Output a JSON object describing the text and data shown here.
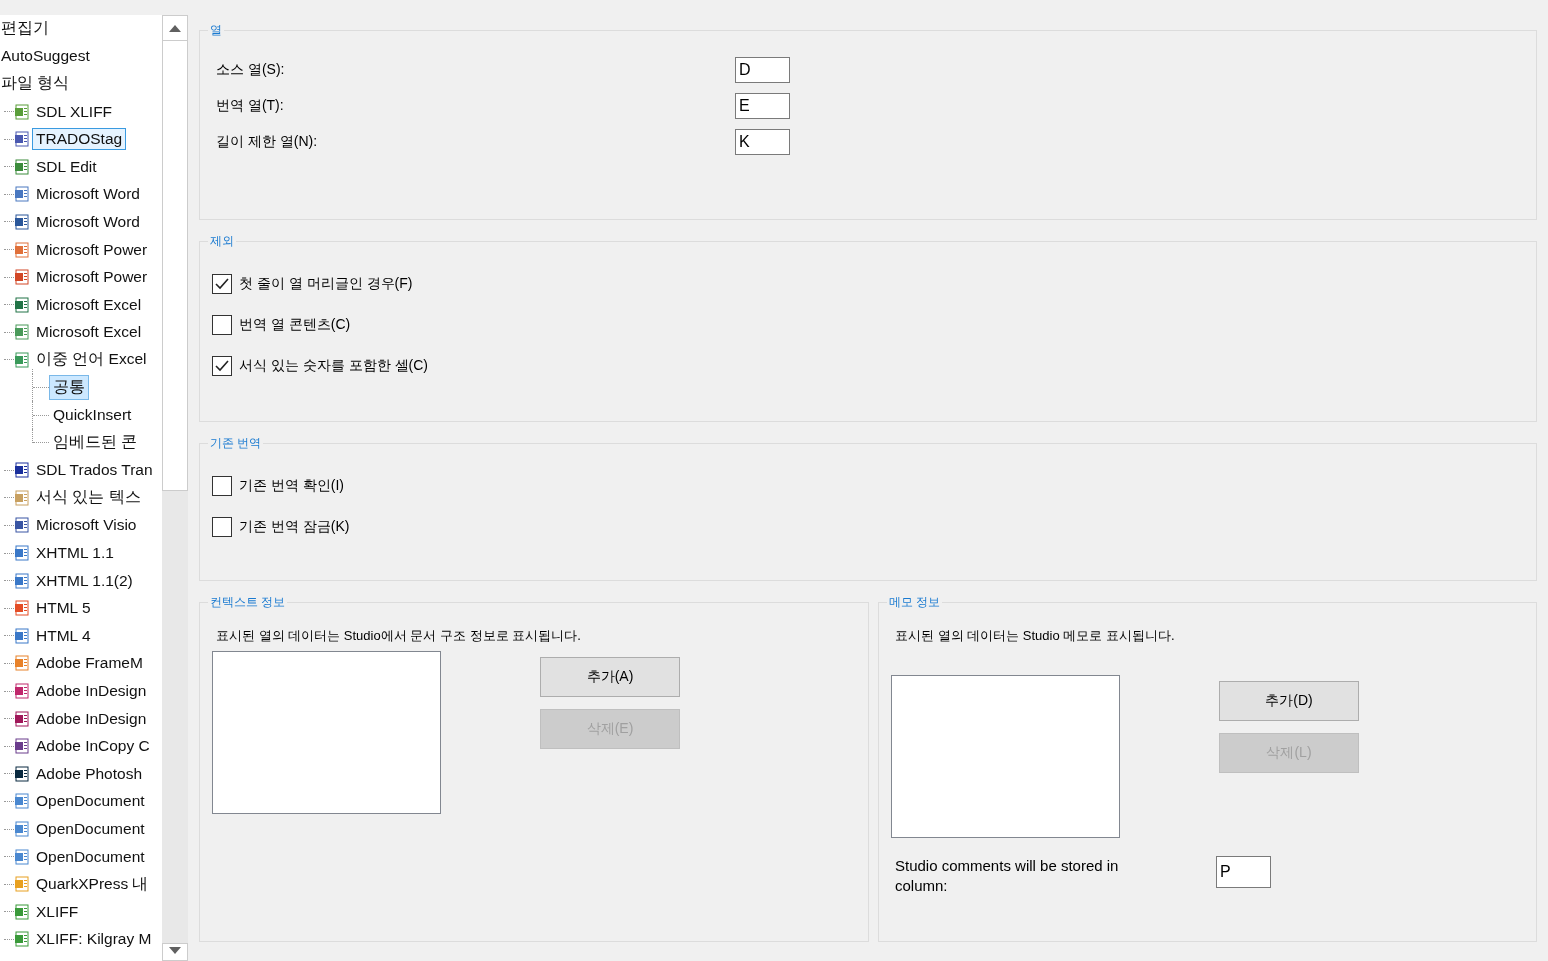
{
  "tree": {
    "items": [
      {
        "label": "편집기",
        "selected": false,
        "hovered": false
      },
      {
        "label": "AutoSuggest",
        "selected": false,
        "hovered": false
      },
      {
        "label": "파일 형식",
        "selected": false,
        "hovered": false,
        "children": [
          {
            "label": "SDL XLIFF",
            "selected": false,
            "hovered": false,
            "color": "#5a9e3a"
          },
          {
            "label": "TRADOStag",
            "selected": false,
            "hovered": true,
            "color": "#4a58b0"
          },
          {
            "label": "SDL Edit",
            "selected": false,
            "hovered": false,
            "color": "#3c8c3c"
          },
          {
            "label": "Microsoft Word",
            "selected": false,
            "hovered": false,
            "color": "#4a78c0"
          },
          {
            "label": "Microsoft Word",
            "selected": false,
            "hovered": false,
            "color": "#2b579a"
          },
          {
            "label": "Microsoft Power",
            "selected": false,
            "hovered": false,
            "color": "#e0703a"
          },
          {
            "label": "Microsoft Power",
            "selected": false,
            "hovered": false,
            "color": "#d24726"
          },
          {
            "label": "Microsoft Excel",
            "selected": false,
            "hovered": false,
            "color": "#217346"
          },
          {
            "label": "Microsoft Excel",
            "selected": false,
            "hovered": false,
            "color": "#4a9a5a"
          },
          {
            "label": "이중 언어 Excel",
            "selected": false,
            "hovered": false,
            "color": "#3a9a5a",
            "children": [
              {
                "label": "공통",
                "selected": true,
                "hovered": false
              },
              {
                "label": "QuickInsert",
                "selected": false,
                "hovered": false
              },
              {
                "label": "임베드된 콘",
                "selected": false,
                "hovered": false
              }
            ]
          },
          {
            "label": "SDL Trados Tran",
            "selected": false,
            "hovered": false,
            "color": "#1a2f9c"
          },
          {
            "label": "서식 있는 텍스",
            "selected": false,
            "hovered": false,
            "color": "#c8a060"
          },
          {
            "label": "Microsoft Visio",
            "selected": false,
            "hovered": false,
            "color": "#3955a3"
          },
          {
            "label": "XHTML 1.1",
            "selected": false,
            "hovered": false,
            "color": "#3a78c8"
          },
          {
            "label": "XHTML 1.1(2)",
            "selected": false,
            "hovered": false,
            "color": "#3a78c8"
          },
          {
            "label": "HTML 5",
            "selected": false,
            "hovered": false,
            "color": "#e44d26"
          },
          {
            "label": "HTML 4",
            "selected": false,
            "hovered": false,
            "color": "#3a78c8"
          },
          {
            "label": "Adobe FrameM",
            "selected": false,
            "hovered": false,
            "color": "#e8822a"
          },
          {
            "label": "Adobe InDesign",
            "selected": false,
            "hovered": false,
            "color": "#c0286c"
          },
          {
            "label": "Adobe InDesign",
            "selected": false,
            "hovered": false,
            "color": "#a0185a"
          },
          {
            "label": "Adobe InCopy C",
            "selected": false,
            "hovered": false,
            "color": "#6a3c8c"
          },
          {
            "label": "Adobe Photosh",
            "selected": false,
            "hovered": false,
            "color": "#0a2a40"
          },
          {
            "label": "OpenDocument",
            "selected": false,
            "hovered": false,
            "color": "#4a88d0"
          },
          {
            "label": "OpenDocument",
            "selected": false,
            "hovered": false,
            "color": "#4a88d0"
          },
          {
            "label": "OpenDocument",
            "selected": false,
            "hovered": false,
            "color": "#4a88d0"
          },
          {
            "label": "QuarkXPress 내",
            "selected": false,
            "hovered": false,
            "color": "#e8a020"
          },
          {
            "label": "XLIFF",
            "selected": false,
            "hovered": false,
            "color": "#3a9a3a"
          },
          {
            "label": "XLIFF: Kilgray M",
            "selected": false,
            "hovered": false,
            "color": "#3a9a3a"
          }
        ]
      }
    ]
  },
  "groups": [
    {
      "kind": "fields",
      "title": "열",
      "fields": [
        {
          "label": "소스 열(S):",
          "value": "D"
        },
        {
          "label": "번역 열(T):",
          "value": "E"
        },
        {
          "label": "길이 제한 열(N):",
          "value": "K"
        }
      ]
    },
    {
      "kind": "checks",
      "title": "제외",
      "checkboxes": [
        {
          "label": "첫 줄이 열 머리글인 경우(F)",
          "checked": true
        },
        {
          "label": "번역 열 콘텐츠(C)",
          "checked": false
        },
        {
          "label": "서식 있는 숫자를 포함한 셀(C)",
          "checked": true
        }
      ]
    },
    {
      "kind": "checks",
      "title": "기존 번역",
      "checkboxes": [
        {
          "label": "기존 번역 확인(I)",
          "checked": false
        },
        {
          "label": "기존 번역 잠금(K)",
          "checked": false
        }
      ]
    },
    {
      "kind": "info",
      "title": "컨텍스트 정보",
      "description": "표시된 열의 데이터는 Studio에서 문서 구조 정보로 표시됩니다.",
      "buttons": [
        {
          "label": "추가(A)",
          "disabled": false
        },
        {
          "label": "삭제(E)",
          "disabled": true
        }
      ]
    },
    {
      "kind": "info",
      "title": "메모 정보",
      "description": "표시된 열의 데이터는 Studio 메모로 표시됩니다.",
      "buttons": [
        {
          "label": "추가(D)",
          "disabled": false
        },
        {
          "label": "삭제(L)",
          "disabled": true
        }
      ],
      "comment_label": "Studio comments will be stored in column:",
      "comment_value": "P"
    }
  ]
}
